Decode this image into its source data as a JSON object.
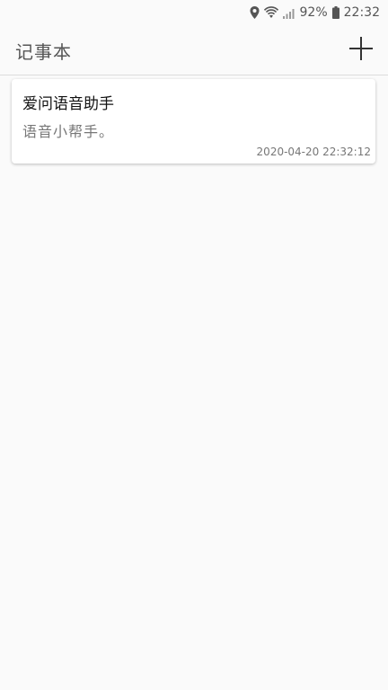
{
  "status_bar": {
    "battery_percent": "92%",
    "time": "22:32",
    "icons": [
      "location-icon",
      "wifi-icon",
      "signal-icon",
      "battery-icon"
    ]
  },
  "app_bar": {
    "title": "记事本",
    "add_icon": "plus-icon"
  },
  "notes": [
    {
      "title": "爱问语音助手",
      "body": "语音小帮手。",
      "timestamp": "2020-04-20 22:32:12"
    }
  ],
  "colors": {
    "background": "#fafafa",
    "card": "#ffffff",
    "title_text": "#111111",
    "secondary_text": "#777777"
  }
}
